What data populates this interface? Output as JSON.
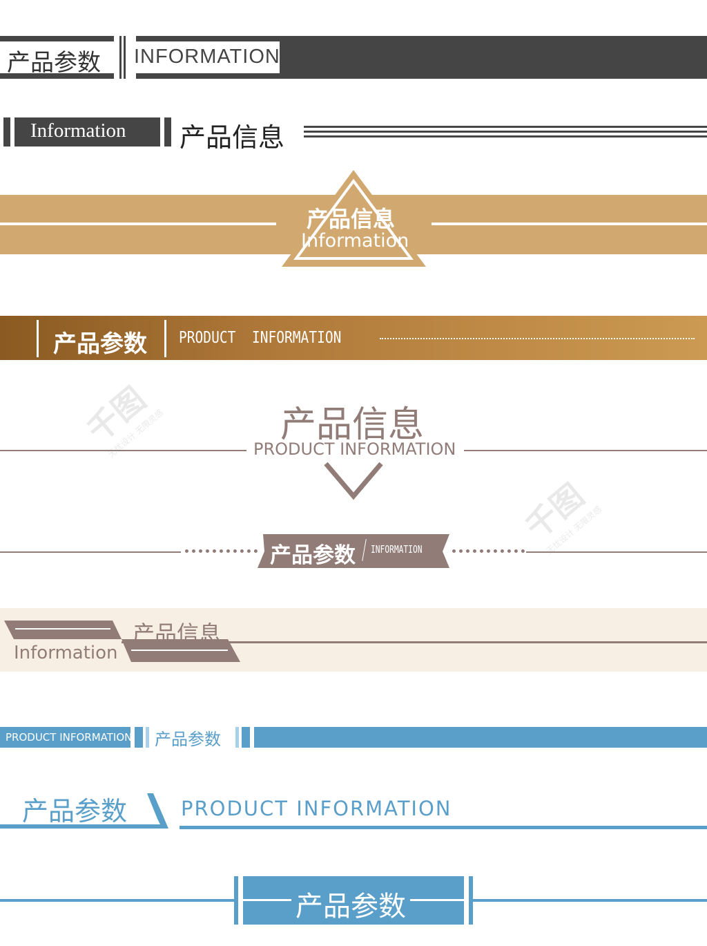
{
  "colors": {
    "dark": "#454545",
    "gold": "#d0a870",
    "brown_start": "#8a5a22",
    "brown_end": "#cc9a52",
    "mauve": "#917c78",
    "cream": "#f8efe4",
    "blue": "#5a9fc9"
  },
  "banner1": {
    "cn": "产品参数",
    "en": "INFORMATION"
  },
  "banner2": {
    "en": "Information",
    "cn": "产品信息"
  },
  "banner3": {
    "cn": "产品信息",
    "en": "Information"
  },
  "banner4": {
    "cn": "产品参数",
    "en": "PRODUCT  INFORMATION"
  },
  "banner5": {
    "cn": "产品信息",
    "en": "PRODUCT INFORMATION"
  },
  "banner6": {
    "cn": "产品参数",
    "en": "INFORMATION"
  },
  "banner7": {
    "cn": "产品信息",
    "en": "Information"
  },
  "banner8": {
    "en": "PRODUCT INFORMATION",
    "cn": "产品参数"
  },
  "banner9": {
    "cn": "产品参数",
    "en": "PRODUCT INFORMATION"
  },
  "banner10": {
    "cn": "产品参数"
  },
  "watermark": {
    "logo": "千图",
    "tagline": "无忧设计 无限灵感"
  }
}
